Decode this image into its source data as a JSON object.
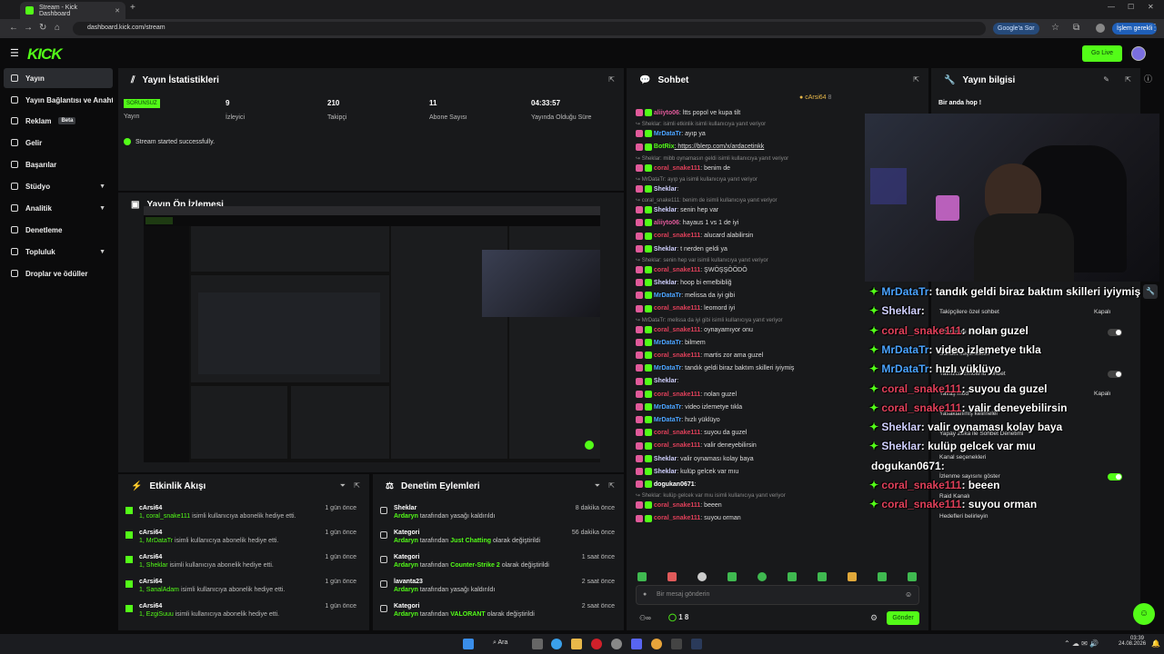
{
  "browser": {
    "tab_title": "Stream - Kick Dashboard",
    "url": "dashboard.kick.com/stream",
    "ask_google": "Google'a Sor",
    "action_required": "İşlem gerekli"
  },
  "topnav": {
    "logo": "KICK",
    "go_live": "Go Live"
  },
  "sidebar": {
    "items": [
      {
        "label": "Yayın"
      },
      {
        "label": "Yayın Bağlantısı ve Anahtar"
      },
      {
        "label": "Reklam",
        "badge": "Beta"
      },
      {
        "label": "Gelir"
      },
      {
        "label": "Başarılar"
      },
      {
        "label": "Stüdyo"
      },
      {
        "label": "Analitik"
      },
      {
        "label": "Denetleme"
      },
      {
        "label": "Topluluk"
      },
      {
        "label": "Droplar ve ödüller"
      }
    ]
  },
  "stats": {
    "title": "Yayın İstatistikleri",
    "status_badge": "SORUNSUZ",
    "status_label": "Yayın",
    "items": [
      {
        "value": "9",
        "label": "İzleyici"
      },
      {
        "value": "210",
        "label": "Takipçi"
      },
      {
        "value": "11",
        "label": "Abone Sayısı"
      },
      {
        "value": "04:33:57",
        "label": "Yayında Olduğu Süre"
      }
    ],
    "message": "Stream started successfully."
  },
  "preview": {
    "title": "Yayın Ön İzlemesi"
  },
  "events": {
    "title": "Etkinlik Akışı",
    "items": [
      {
        "name": "cArsi64",
        "num": "1,",
        "target": "coral_snake111",
        "desc": "isimli kullanıcıya abonelik hediye etti.",
        "time": "1 gün önce"
      },
      {
        "name": "cArsi64",
        "num": "1,",
        "target": "MrDataTr",
        "desc": "isimli kullanıcıya abonelik hediye etti.",
        "time": "1 gün önce"
      },
      {
        "name": "cArsi64",
        "num": "1,",
        "target": "Sheklar",
        "desc": "isimli kullanıcıya abonelik hediye etti.",
        "time": "1 gün önce"
      },
      {
        "name": "cArsi64",
        "num": "1,",
        "target": "SanalAdam",
        "desc": "isimli kullanıcıya abonelik hediye etti.",
        "time": "1 gün önce"
      },
      {
        "name": "cArsi64",
        "num": "1,",
        "target": "EzgiSuuu",
        "desc": "isimli kullanıcıya abonelik hediye etti.",
        "time": "1 gün önce"
      }
    ]
  },
  "moderation": {
    "title": "Denetim Eylemleri",
    "items": [
      {
        "name": "Sheklar",
        "actor": "Ardaryn",
        "pre": "tarafından yasağı kaldırıldı",
        "hl": "",
        "post": "",
        "time": "8 dakika önce"
      },
      {
        "name": "Kategori",
        "actor": "Ardaryn",
        "pre": "tarafından",
        "hl": "Just Chatting",
        "post": "olarak değiştirildi",
        "time": "56 dakika önce"
      },
      {
        "name": "Kategori",
        "actor": "Ardaryn",
        "pre": "tarafından",
        "hl": "Counter-Strike 2",
        "post": "olarak değiştirildi",
        "time": "1 saat önce"
      },
      {
        "name": "lavanta23",
        "actor": "Ardaryn",
        "pre": "tarafından yasağı kaldırıldı",
        "hl": "",
        "post": "",
        "time": "2 saat önce"
      },
      {
        "name": "Kategori",
        "actor": "Ardaryn",
        "pre": "tarafından",
        "hl": "VALORANT",
        "post": "olarak değiştirildi",
        "time": "2 saat önce"
      }
    ]
  },
  "chat": {
    "title": "Sohbet",
    "pinned_user": "cArsi64",
    "pinned_count": "8",
    "lines": [
      {
        "type": "msg",
        "user": "aliiyto06",
        "color": "#e05a9a",
        "text": ": ltts popol ve kupa tilt"
      },
      {
        "type": "reply",
        "text": "Sheklar: isimli etkinlik isimli kullanıcıya yanıt veriyor"
      },
      {
        "type": "msg",
        "user": "MrDataTr",
        "color": "#4aa3ff",
        "text": ": ayıp ya"
      },
      {
        "type": "msg",
        "user": "BotRix",
        "color": "#53fc18",
        "text": ": https://blerp.com/x/ardacetinkk"
      },
      {
        "type": "reply",
        "text": "Sheklar: mibb oynamasın geldi isimli kullanıcıya yanıt veriyor"
      },
      {
        "type": "msg",
        "user": "coral_snake111",
        "color": "#e0405a",
        "text": ": benim de"
      },
      {
        "type": "reply",
        "text": "MrDataTr: ayıp ya isimli kullanıcıya yanıt veriyor"
      },
      {
        "type": "msg",
        "user": "Sheklar",
        "color": "#d0d0ff",
        "text": ":"
      },
      {
        "type": "reply",
        "text": "coral_snake111: benim de isimli kullanıcıya yanıt veriyor"
      },
      {
        "type": "msg",
        "user": "Sheklar",
        "color": "#d0d0ff",
        "text": ": senin hep var"
      },
      {
        "type": "msg",
        "user": "aliiyto06",
        "color": "#e05a9a",
        "text": ": hayaus 1 vs 1 de iyi"
      },
      {
        "type": "msg",
        "user": "coral_snake111",
        "color": "#e0405a",
        "text": ": alucard alabilirsin"
      },
      {
        "type": "msg",
        "user": "Sheklar",
        "color": "#d0d0ff",
        "text": ": t nerden geldi ya"
      },
      {
        "type": "reply",
        "text": "Sheklar: senin hep var isimli kullanıcıya yanıt veriyor"
      },
      {
        "type": "msg",
        "user": "coral_snake111",
        "color": "#e0405a",
        "text": ": ŞWÖŞŞÖÖDÖ"
      },
      {
        "type": "msg",
        "user": "Sheklar",
        "color": "#d0d0ff",
        "text": ": hoop bi emelbibliğ"
      },
      {
        "type": "msg",
        "user": "MrDataTr",
        "color": "#4aa3ff",
        "text": ": melissa da iyi gibi"
      },
      {
        "type": "msg",
        "user": "coral_snake111",
        "color": "#e0405a",
        "text": ": leomord iyi"
      },
      {
        "type": "reply",
        "text": "MrDataTr: melissa da iyi gibi isimli kullanıcıya yanıt veriyor"
      },
      {
        "type": "msg",
        "user": "coral_snake111",
        "color": "#e0405a",
        "text": ": oynayamıyor onu"
      },
      {
        "type": "msg",
        "user": "MrDataTr",
        "color": "#4aa3ff",
        "text": ": bilmem"
      },
      {
        "type": "msg",
        "user": "coral_snake111",
        "color": "#e0405a",
        "text": ": martis zor ama guzel"
      },
      {
        "type": "msg",
        "user": "MrDataTr",
        "color": "#4aa3ff",
        "text": ": tandık geldi biraz baktım skilleri iyiymiş"
      },
      {
        "type": "msg",
        "user": "Sheklar",
        "color": "#d0d0ff",
        "text": ":"
      },
      {
        "type": "msg",
        "user": "coral_snake111",
        "color": "#e0405a",
        "text": ": nolan guzel"
      },
      {
        "type": "msg",
        "user": "MrDataTr",
        "color": "#4aa3ff",
        "text": ": video izlemetye tıkla"
      },
      {
        "type": "msg",
        "user": "MrDataTr",
        "color": "#4aa3ff",
        "text": ": hızlı yüklüyo"
      },
      {
        "type": "msg",
        "user": "coral_snake111",
        "color": "#e0405a",
        "text": ": suyou da guzel"
      },
      {
        "type": "msg",
        "user": "coral_snake111",
        "color": "#e0405a",
        "text": ": valir deneyebilirsin"
      },
      {
        "type": "msg",
        "user": "Sheklar",
        "color": "#d0d0ff",
        "text": ": valir oynaması kolay baya"
      },
      {
        "type": "msg",
        "user": "Sheklar",
        "color": "#d0d0ff",
        "text": ": kulüp gelcek var mıu"
      },
      {
        "type": "msg",
        "user": "dogukan0671",
        "color": "#ffffff",
        "text": ":"
      },
      {
        "type": "reply",
        "text": "Sheklar: kulüp gelcek var mıu isimli kullanıcıya yanıt veriyor"
      },
      {
        "type": "msg",
        "user": "coral_snake111",
        "color": "#e0405a",
        "text": ": beeen"
      },
      {
        "type": "msg",
        "user": "coral_snake111",
        "color": "#e0405a",
        "text": ": suyou orman"
      }
    ],
    "input_placeholder": "Bir mesaj gönderin",
    "viewer_count": "1 8",
    "send": "Gönder"
  },
  "info": {
    "title": "Yayın bilgisi",
    "stream_title": "Bir anda hop !",
    "settings": [
      {
        "label": "Takipçilere özel sohbet",
        "value": "Kapalı"
      },
      {
        "label": "Abonelere özel sohbet",
        "value": ""
      },
      {
        "label": "Sohbet seçenekleri",
        "value": ""
      },
      {
        "label": "Yalnızca Emote'lu sohbet",
        "value": ""
      },
      {
        "label": "Yavaş mod",
        "value": "Kapalı"
      },
      {
        "label": "Yasaklanmış kelimeler",
        "value": ""
      },
      {
        "label": "Yapay Zeka ile Sohbet Denetimi",
        "value": ""
      },
      {
        "label": "Kanal seçenekleri",
        "value": ""
      },
      {
        "label": "İzlenme sayısını göster",
        "value": ""
      },
      {
        "label": "Raid Kanalı",
        "value": ""
      },
      {
        "label": "Hedefleri belirleyin",
        "value": ""
      }
    ]
  },
  "overlay_chat": [
    {
      "user": "MrDataTr",
      "color": "#4aa3ff",
      "text": ": tandık geldi biraz baktım skilleri iyiymiş"
    },
    {
      "user": "Sheklar",
      "color": "#d0d0ff",
      "text": ":"
    },
    {
      "user": "coral_snake111",
      "color": "#e0405a",
      "text": ": nolan guzel"
    },
    {
      "user": "MrDataTr",
      "color": "#4aa3ff",
      "text": ": video izlemetye tıkla"
    },
    {
      "user": "MrDataTr",
      "color": "#4aa3ff",
      "text": ": hızlı yüklüyo"
    },
    {
      "user": "coral_snake111",
      "color": "#e0405a",
      "text": ": suyou da guzel"
    },
    {
      "user": "coral_snake111",
      "color": "#e0405a",
      "text": ": valir deneyebilirsin"
    },
    {
      "user": "Sheklar",
      "color": "#d0d0ff",
      "text": ": valir oynaması kolay baya"
    },
    {
      "user": "Sheklar",
      "color": "#d0d0ff",
      "text": ": kulüp gelcek var mıu"
    },
    {
      "user": "dogukan0671",
      "color": "#ffffff",
      "text": ":"
    },
    {
      "user": "coral_snake111",
      "color": "#e0405a",
      "text": ": beeen"
    },
    {
      "user": "coral_snake111",
      "color": "#e0405a",
      "text": ": suyou orman"
    }
  ],
  "taskbar": {
    "search": "Ara",
    "time": "03:39",
    "date": "24.08.2026"
  }
}
